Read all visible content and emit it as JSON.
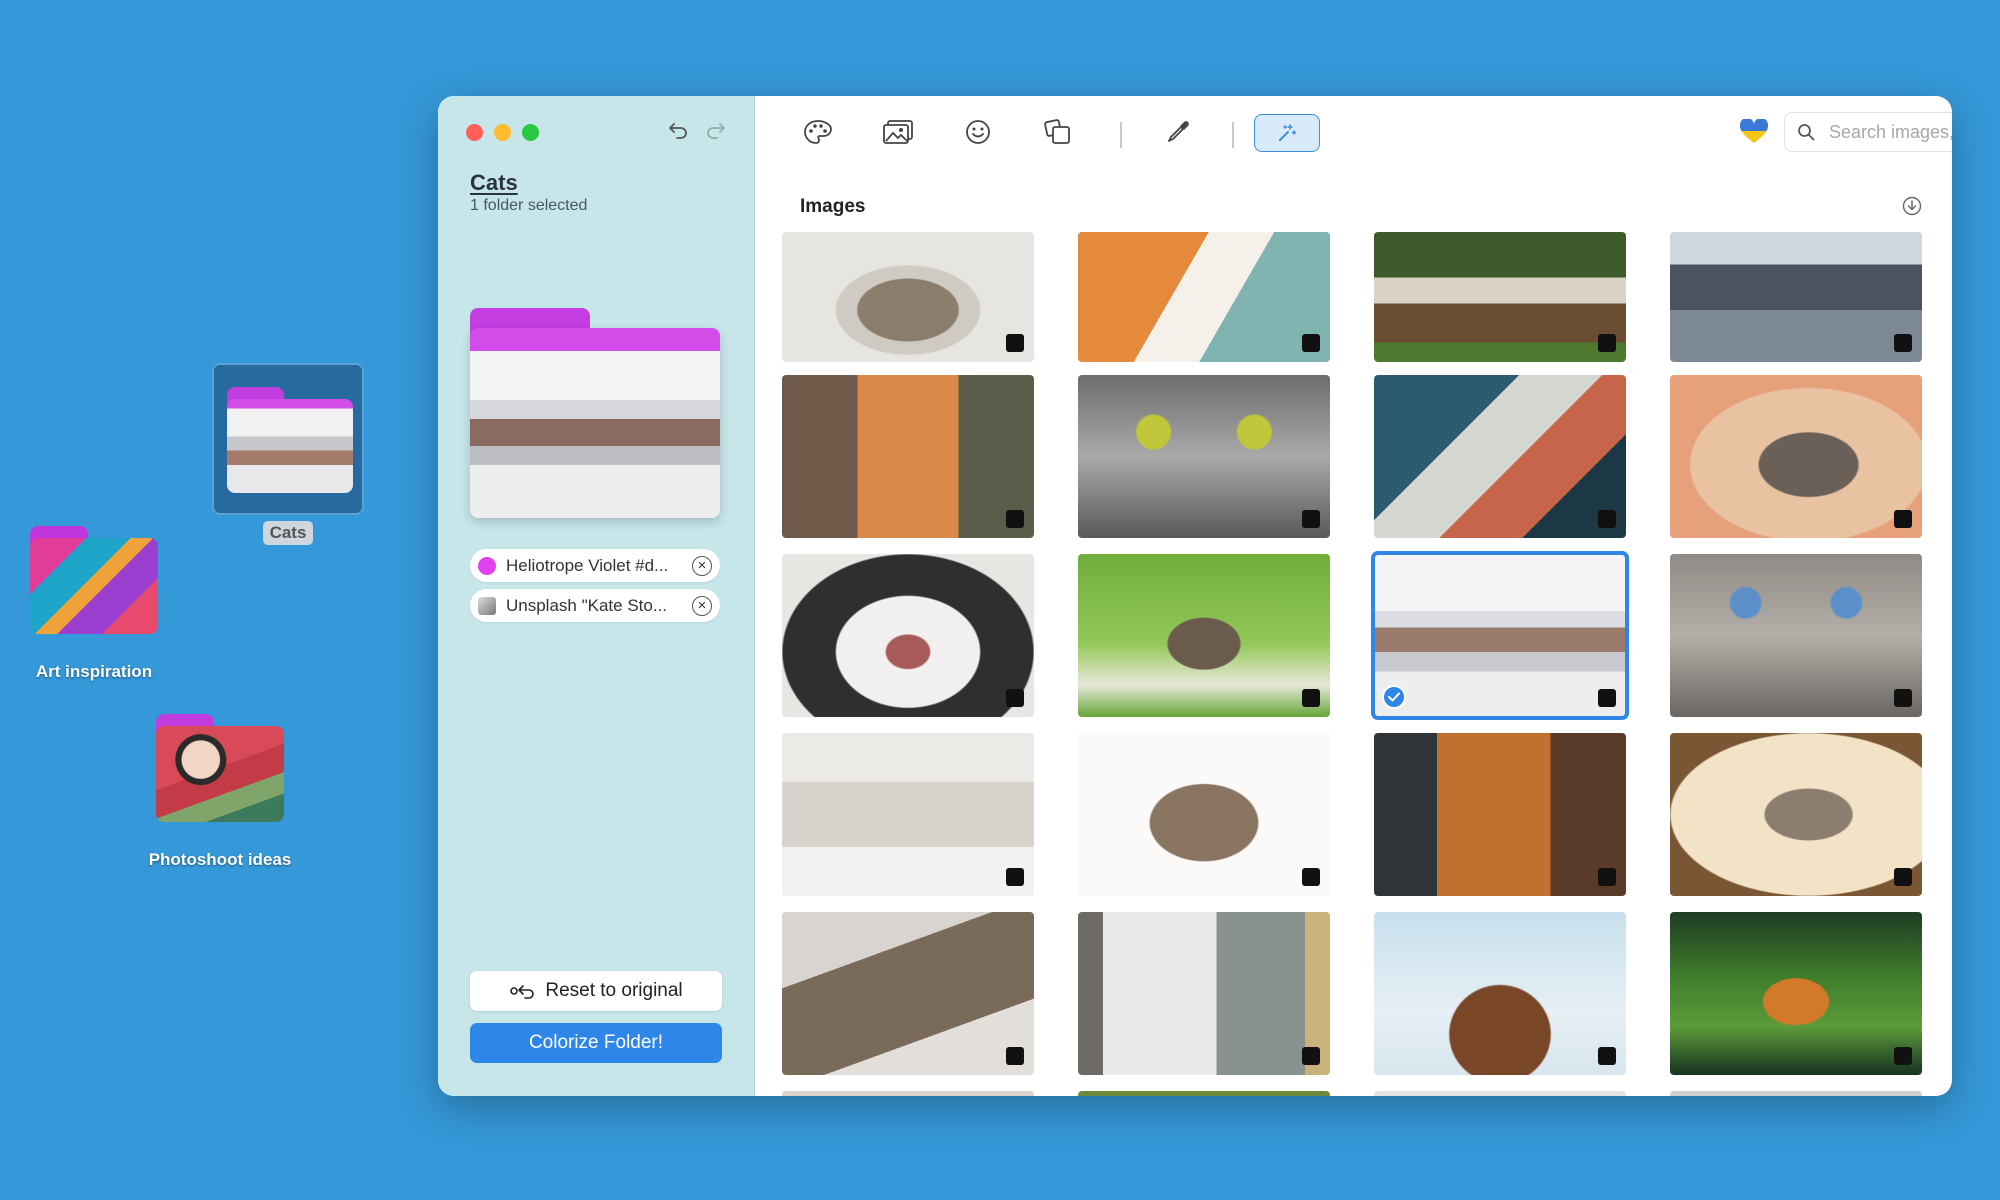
{
  "desktop": {
    "items": [
      {
        "label": "Cats"
      },
      {
        "label": "Art inspiration"
      },
      {
        "label": "Photoshoot ideas"
      }
    ]
  },
  "sidebar": {
    "folder_name": "Cats",
    "selection_info": "1 folder selected",
    "chips": [
      {
        "label": "Heliotrope Violet #d...",
        "color": "#e040f0"
      },
      {
        "label": "Unsplash \"Kate Sto..."
      }
    ],
    "reset_label": "Reset to original",
    "colorize_label": "Colorize Folder!"
  },
  "toolbar": {
    "search_placeholder": "Search images, emojis, decals & keywords",
    "icons": [
      "palette-icon",
      "images-icon",
      "emoji-icon",
      "shapes-icon",
      "eyedropper-icon",
      "magic-wand-icon",
      "heart-icon",
      "search-icon"
    ]
  },
  "main": {
    "section_title": "Images"
  },
  "colors": {
    "desktop": "#3598d8",
    "sidebar": "#c7e6ea",
    "accent": "#2e86e8",
    "folder_tab": "#c339e0"
  }
}
